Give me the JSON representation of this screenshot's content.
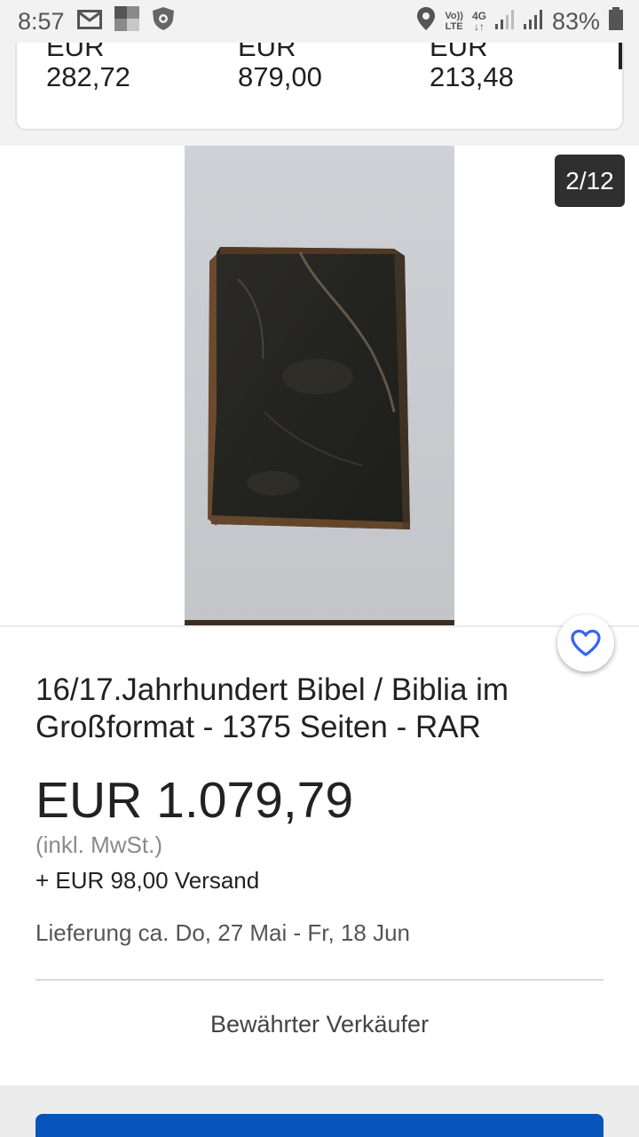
{
  "status_bar": {
    "time": "8:57",
    "battery": "83%",
    "network_label": "4G",
    "volte_label_top": "Vo))",
    "volte_label_bottom": "LTE"
  },
  "similar_items": [
    {
      "currency": "EUR",
      "price": "282,72"
    },
    {
      "currency": "EUR",
      "price": "879,00"
    },
    {
      "currency": "EUR",
      "price": "213,48"
    }
  ],
  "gallery": {
    "counter": "2/12"
  },
  "listing": {
    "title": "16/17.Jahrhundert Bibel / Biblia im Großformat - 1375 Seiten - RAR",
    "price": "EUR 1.079,79",
    "tax_note": "(inkl. MwSt.)",
    "shipping": "+ EUR 98,00 Versand",
    "delivery": "Lieferung ca. Do, 27 Mai - Fr, 18 Jun",
    "seller_badge": "Bewährter Verkäufer"
  },
  "colors": {
    "accent_blue": "#0654ba",
    "heart_blue": "#3665f3"
  }
}
